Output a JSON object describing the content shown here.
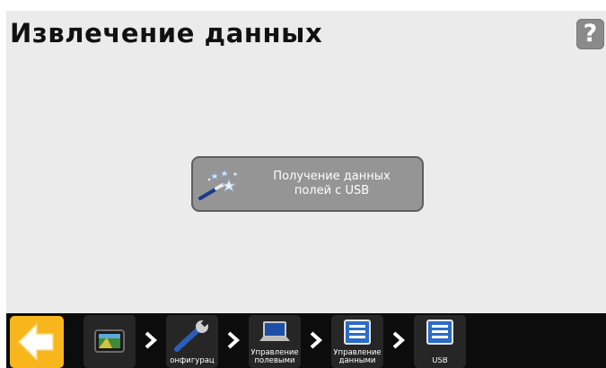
{
  "header": {
    "title": "Извлечение данных",
    "help_label": "?"
  },
  "action": {
    "label": "Получение данных\nполей с USB",
    "icon": "magic-wand-icon"
  },
  "bottom_bar": {
    "back_icon": "arrow-left-icon",
    "breadcrumbs": [
      {
        "label": "",
        "icon": "display-icon"
      },
      {
        "label": "онфигурац",
        "icon": "wrench-icon"
      },
      {
        "label": "Управление\nполевыми",
        "icon": "laptop-icon"
      },
      {
        "label": "Управление\nданными",
        "icon": "list-icon"
      },
      {
        "label": "USB",
        "icon": "list-icon"
      }
    ]
  },
  "colors": {
    "screen_bg": "#ebebeb",
    "bottom_bar_bg": "#0c0c0c",
    "back_button": "#f6b61c",
    "action_button": "#959595",
    "help_button": "#8a8a8a"
  }
}
